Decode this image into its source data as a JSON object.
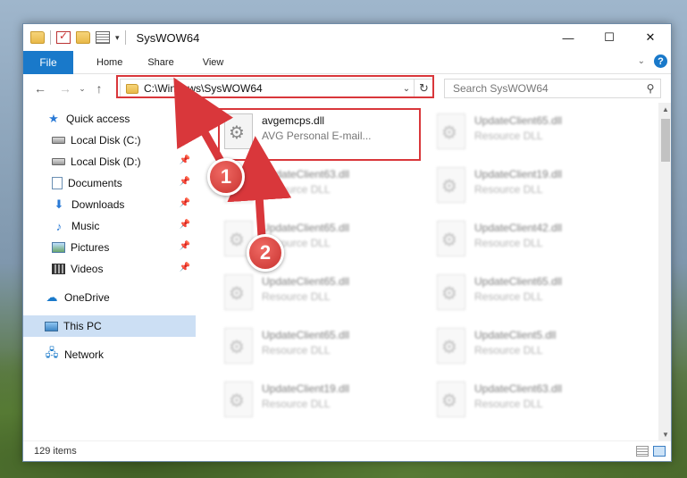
{
  "window": {
    "title": "SysWOW64",
    "controls": {
      "minimize": "—",
      "maximize": "☐",
      "close": "✕"
    }
  },
  "ribbon": {
    "tabs": [
      "File",
      "Home",
      "Share",
      "View"
    ],
    "help": "?"
  },
  "navigation": {
    "address": "C:\\Windows\\SysWOW64",
    "search_placeholder": "Search SysWOW64"
  },
  "sidebar": {
    "quick_access": "Quick access",
    "items": [
      {
        "label": "Local Disk (C:)",
        "icon": "disk-icon"
      },
      {
        "label": "Local Disk (D:)",
        "icon": "disk-icon"
      },
      {
        "label": "Documents",
        "icon": "documents-icon"
      },
      {
        "label": "Downloads",
        "icon": "downloads-icon"
      },
      {
        "label": "Music",
        "icon": "music-icon"
      },
      {
        "label": "Pictures",
        "icon": "pictures-icon"
      },
      {
        "label": "Videos",
        "icon": "videos-icon"
      }
    ],
    "onedrive": "OneDrive",
    "this_pc": "This PC",
    "network": "Network"
  },
  "files": [
    {
      "name": "avgemcps.dll",
      "type": "AVG Personal E-mail..."
    },
    {
      "name": "UpdateClient65.dll",
      "type": "Resource DLL"
    },
    {
      "name": "UpdateClient63.dll",
      "type": "Resource DLL"
    },
    {
      "name": "UpdateClient19.dll",
      "type": "Resource DLL"
    },
    {
      "name": "UpdateClient65.dll",
      "type": "Resource DLL"
    },
    {
      "name": "UpdateClient42.dll",
      "type": "Resource DLL"
    },
    {
      "name": "UpdateClient65.dll",
      "type": "Resource DLL"
    },
    {
      "name": "UpdateClient65.dll",
      "type": "Resource DLL"
    },
    {
      "name": "UpdateClient65.dll",
      "type": "Resource DLL"
    },
    {
      "name": "UpdateClient5.dll",
      "type": "Resource DLL"
    },
    {
      "name": "UpdateClient19.dll",
      "type": "Resource DLL"
    },
    {
      "name": "UpdateClient63.dll",
      "type": "Resource DLL"
    }
  ],
  "status": {
    "item_count": "129 items"
  },
  "annotations": {
    "step1": "1",
    "step2": "2",
    "color": "#d9373b"
  }
}
